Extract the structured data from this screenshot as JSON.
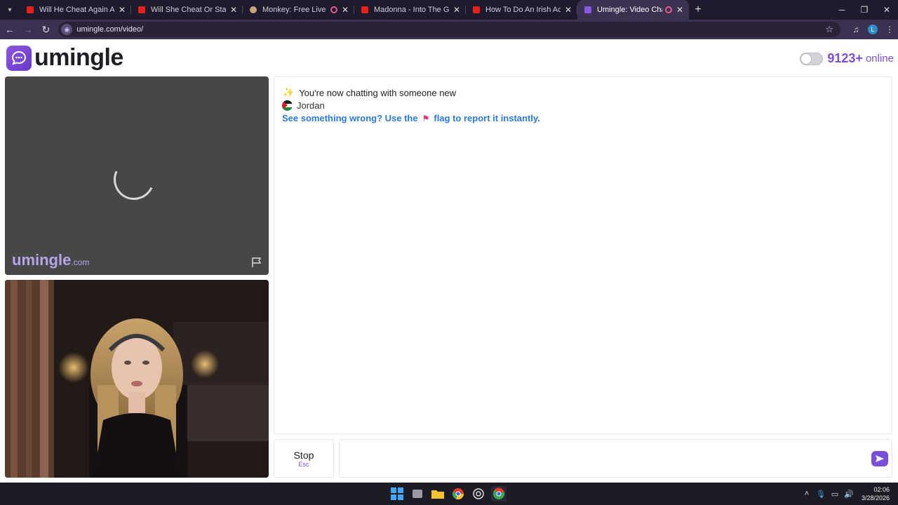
{
  "browser": {
    "tabs": [
      {
        "title": "Will He Cheat Again After She",
        "favicon": "youtube-icon",
        "audio": false,
        "active": false
      },
      {
        "title": "Will She Cheat Or Stay Loyal Af",
        "favicon": "youtube-icon",
        "audio": false,
        "active": false
      },
      {
        "title": "Monkey: Free Live Video Ch",
        "favicon": "monkey-icon",
        "audio": true,
        "active": false
      },
      {
        "title": "Madonna - Into The Groove - Y",
        "favicon": "youtube-icon",
        "audio": false,
        "active": false
      },
      {
        "title": "How To Do An Irish Accent In U",
        "favicon": "youtube-icon",
        "audio": false,
        "active": false
      },
      {
        "title": "Umingle: Video Chat with S",
        "favicon": "umingle-icon",
        "audio": true,
        "active": true
      }
    ],
    "address": "umingle.com/video/",
    "profile_initial": "L"
  },
  "site": {
    "logo_text": "umingle",
    "online_count": "9123+",
    "online_label": "online",
    "watermark_main": "umingle",
    "watermark_suffix": ".com"
  },
  "chat": {
    "status_line": "You're now chatting with someone new",
    "partner_name": "Jordan",
    "report_text_before": "See something wrong? Use the",
    "report_text_after": "flag to report it instantly."
  },
  "controls": {
    "stop_label": "Stop",
    "stop_shortcut": "Esc",
    "message_placeholder": ""
  },
  "taskbar": {
    "time": "02:06",
    "date": "3/28/2026"
  },
  "colors": {
    "accent": "#7a4fd8",
    "link": "#2a7ad6",
    "chrome_bg": "#3a3250"
  }
}
